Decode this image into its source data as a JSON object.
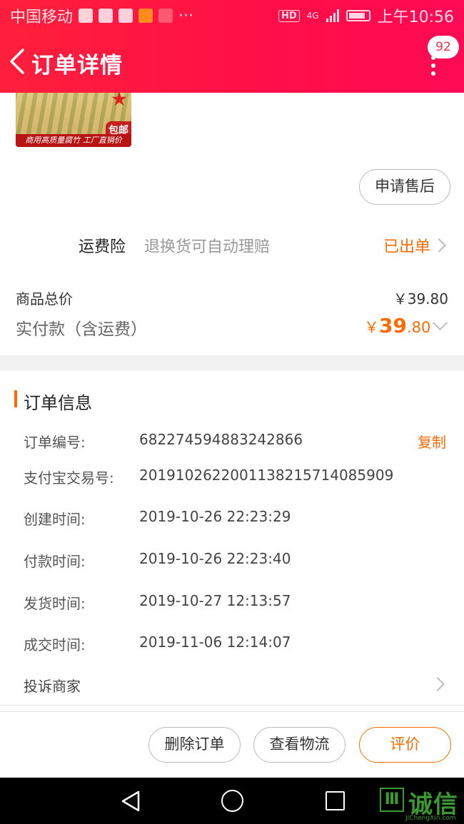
{
  "status_bar": {
    "carrier": "中国移动",
    "time": "上午10:56",
    "hd_label": "HD",
    "network": "4G",
    "more_indicator": "···"
  },
  "header": {
    "title": "订单详情",
    "badge_count": "92"
  },
  "product": {
    "image_tag": "包邮",
    "image_caption": "商用高质量腐竹 工厂直销价"
  },
  "aftersale_button": "申请售后",
  "shipping_insurance": {
    "label": "运费险",
    "description": "退换货可自动理赔",
    "status": "已出单"
  },
  "totals": {
    "goods_total_label": "商品总价",
    "goods_total_value": "￥39.80",
    "paid_label": "实付款（含运费）",
    "paid_currency": "￥",
    "paid_integer": "39",
    "paid_decimal": ".80"
  },
  "order_info": {
    "section_title": "订单信息",
    "copy_label": "复制",
    "rows": [
      {
        "label": "订单编号:",
        "value": "682274594883242866"
      },
      {
        "label": "支付宝交易号:",
        "value": "2019102622001138215714085909"
      },
      {
        "label": "创建时间:",
        "value": "2019-10-26 22:23:29"
      },
      {
        "label": "付款时间:",
        "value": "2019-10-26 22:23:40"
      },
      {
        "label": "发货时间:",
        "value": "2019-10-27 12:13:57"
      },
      {
        "label": "成交时间:",
        "value": "2019-11-06 12:14:07"
      }
    ],
    "complaint_label": "投诉商家"
  },
  "bottom_actions": {
    "delete": "删除订单",
    "logistics": "查看物流",
    "rate": "评价"
  },
  "watermark": {
    "mark": "Ⅲ",
    "text": "诚信",
    "sub": "JiChengXin.com"
  },
  "colors": {
    "header_red": "#ff1f3b",
    "accent_orange": "#ff6a00",
    "watermark_green": "#3a9a30"
  }
}
